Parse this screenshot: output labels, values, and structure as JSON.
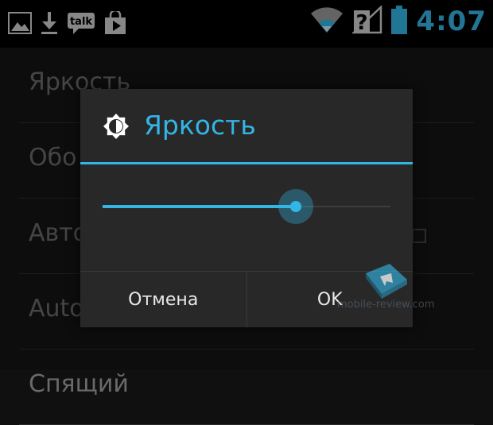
{
  "status_bar": {
    "time": "4:07",
    "icons_left": [
      "gallery-icon",
      "download-icon",
      "talk-icon",
      "play-store-icon"
    ],
    "talk_label": "talk",
    "icons_right": [
      "wifi-icon",
      "no-sim-signal-icon",
      "battery-icon"
    ],
    "accent": "#33b5e5"
  },
  "settings_list": {
    "items": [
      {
        "label": "Яркость"
      },
      {
        "label": "Обо"
      },
      {
        "label": "Авто"
      },
      {
        "label": "Auto"
      },
      {
        "label": "Спящий"
      }
    ]
  },
  "dialog": {
    "title": "Яркость",
    "icon": "brightness-icon",
    "brightness_level": 0.67,
    "cancel_label": "Отмена",
    "ok_label": "OK",
    "accent": "#33b5e5"
  },
  "watermark": {
    "text": "mobile-review.com"
  }
}
